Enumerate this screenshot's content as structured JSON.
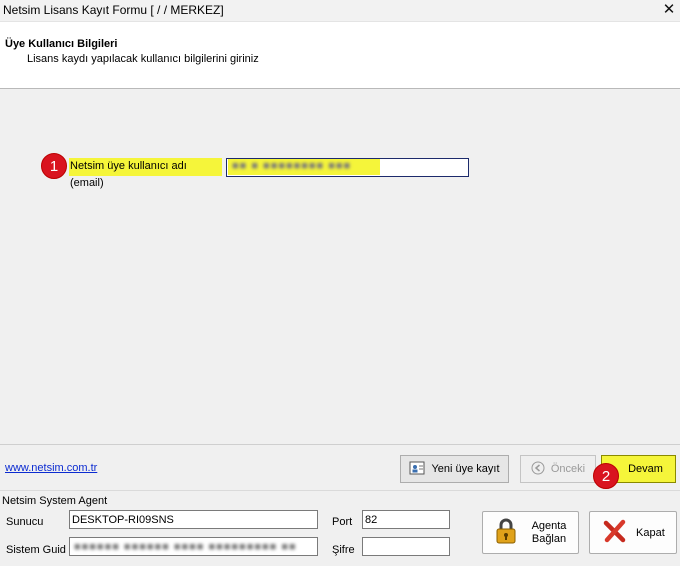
{
  "window": {
    "title": "Netsim Lisans Kayıt Formu [  /  / MERKEZ]",
    "close_glyph": "✕"
  },
  "header": {
    "title": "Üye Kullanıcı Bilgileri",
    "subtitle": "Lisans kaydı yapılacak kullanıcı bilgilerini giriniz"
  },
  "form": {
    "email_label": "Netsim üye kullanıcı adı (email)",
    "email_value": ""
  },
  "markers": {
    "one": "1",
    "two": "2"
  },
  "footer": {
    "link": "www.netsim.com.tr",
    "buttons": {
      "new_member": "Yeni üye kayıt",
      "previous": "Önceki",
      "next": "Devam"
    }
  },
  "agent": {
    "section_title": "Netsim System Agent",
    "server_label": "Sunucu",
    "server_value": "DESKTOP-RI09SNS",
    "port_label": "Port",
    "port_value": "82",
    "guid_label": "Sistem Guid",
    "guid_value": "",
    "password_label": "Şifre",
    "password_value": "",
    "connect_button": "Agenta Bağlan",
    "close_button": "Kapat"
  },
  "colors": {
    "highlight": "#f5f53a",
    "marker": "#d9141f",
    "link": "#0b2bd1"
  },
  "icons": [
    "close-icon",
    "new-member-icon",
    "back-arrow-icon",
    "lock-icon",
    "x-icon"
  ]
}
